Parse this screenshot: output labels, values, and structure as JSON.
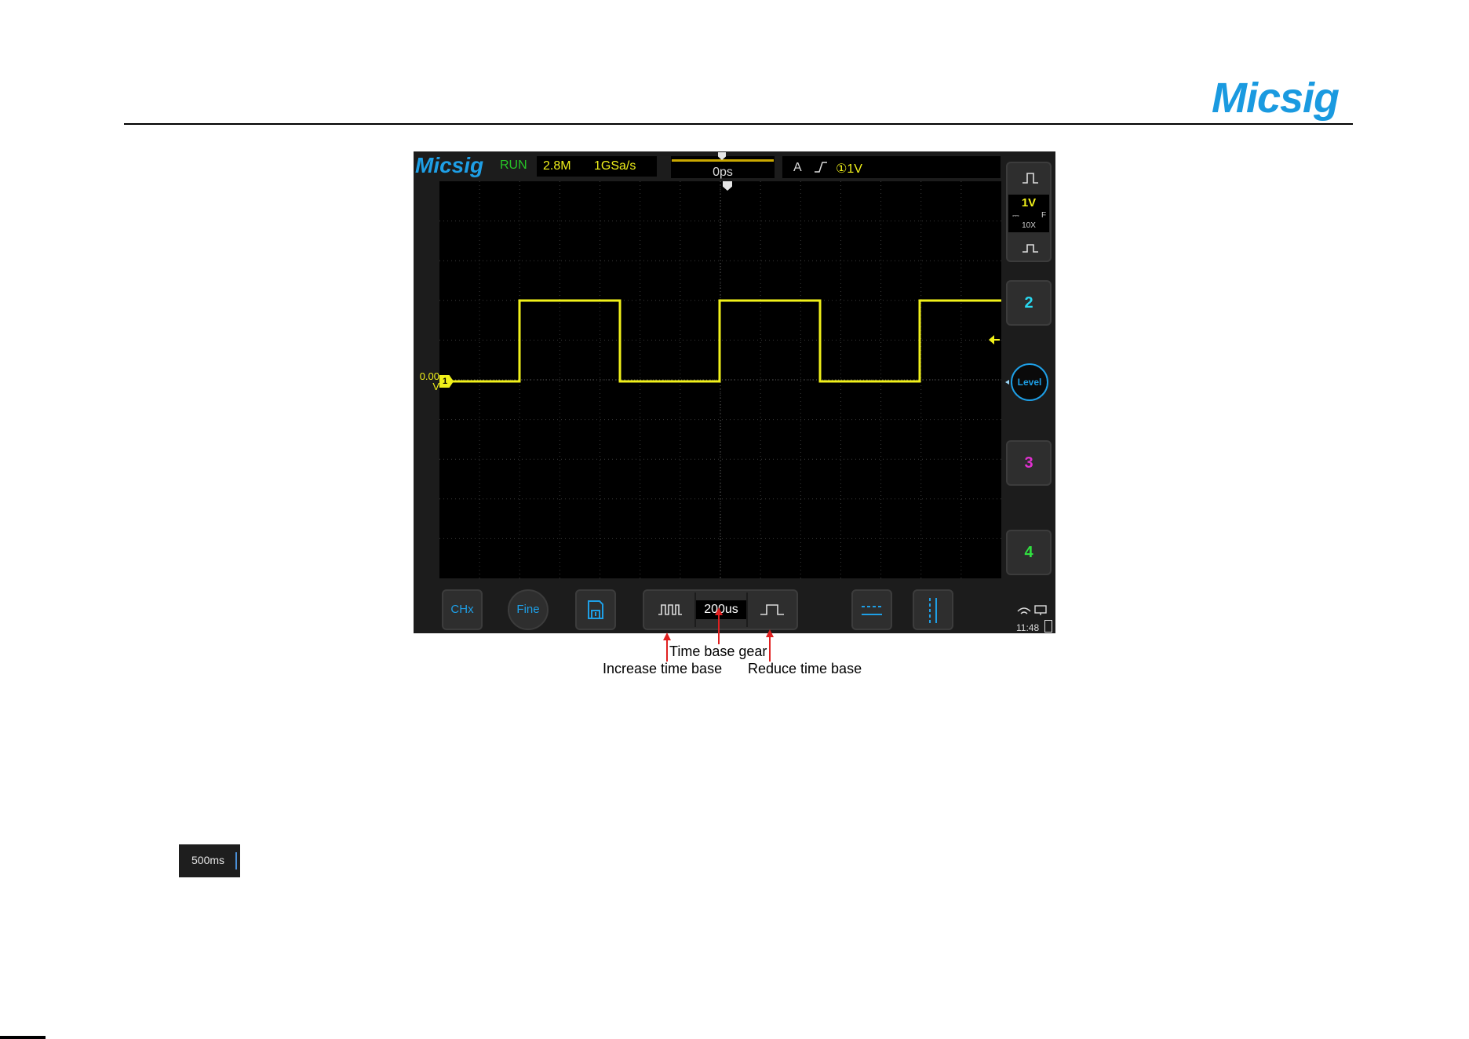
{
  "page": {
    "logo": "Micsig"
  },
  "scope": {
    "brand": "Micsig",
    "status": "RUN",
    "memory_depth": "2.8M",
    "sample_rate": "1GSa/s",
    "trigger_position": "0ps",
    "trigger": {
      "mode": "A",
      "edge": "rising-edge-icon",
      "level": "①1V"
    },
    "ch1": {
      "marker": "1",
      "offset_value": "0.00",
      "offset_unit": "V",
      "scale": "1V",
      "coupling": "⎓",
      "bandwidth": "F",
      "probe": "10X"
    },
    "channels": [
      "2",
      "3",
      "4"
    ],
    "channel_colors": {
      "ch1": "#f1f11a",
      "ch2": "#28d8f0",
      "ch3": "#e030d0",
      "ch4": "#30e040"
    },
    "level_button": "Level",
    "toolbar": {
      "chx": "CHx",
      "fine": "Fine",
      "timebase_gear": "200us"
    },
    "clock": "11:48"
  },
  "annotations": {
    "time_base_gear": "Time base gear",
    "increase_time_base": "Increase time base",
    "reduce_time_base": "Reduce time base"
  },
  "badge": {
    "value": "500ms"
  }
}
